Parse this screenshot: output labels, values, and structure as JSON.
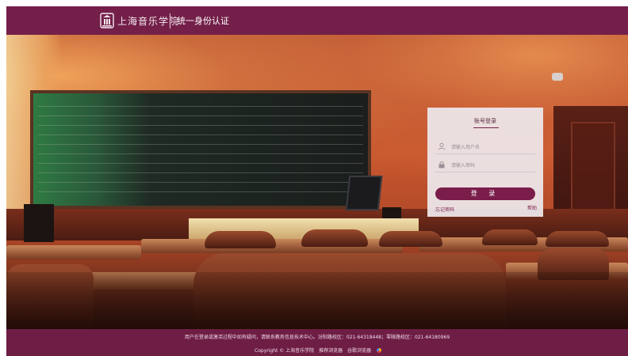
{
  "header": {
    "school_name": "上海音乐学院",
    "system_name": "统一身份认证"
  },
  "login": {
    "title": "账号登录",
    "username_placeholder": "请输入用户名",
    "password_placeholder": "请输入密码",
    "submit_label": "登 录",
    "forgot_label": "忘记密码",
    "help_label": "帮助"
  },
  "footer": {
    "notice": "用户在登录或激活过程中如有疑问，请联系教务信息技术中心。汾阳路校区：021-64318448；零陵路校区：021-64180969",
    "copyright": "Copyright © 上海音乐学院",
    "link1": "推荐浏览器",
    "link2": "谷歌浏览器"
  },
  "colors": {
    "brand": "#731f49",
    "button": "#7a1d4a",
    "panel": "#eee8ec"
  },
  "icons": {
    "logo": "school-seal-icon",
    "username": "user-icon",
    "password": "lock-icon",
    "browser": "chrome-icon"
  }
}
